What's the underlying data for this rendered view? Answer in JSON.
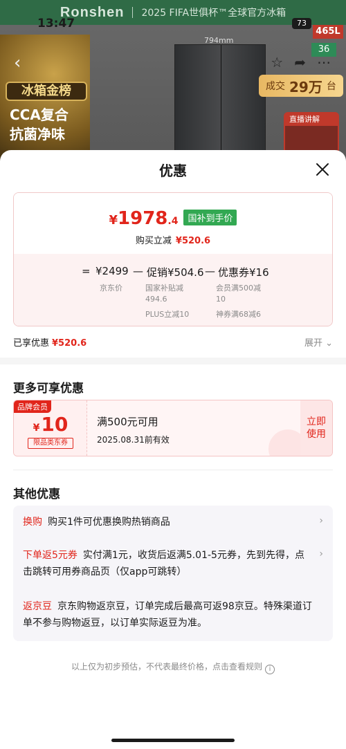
{
  "background": {
    "brand": "Ronshen",
    "banner_text": "2025 FIFA世俱杯™全球官方冰箱",
    "status_time": "13:47",
    "battery": "73",
    "rank_label": "冰箱金榜",
    "cca_line1": "CCA复合",
    "cca_line2": "抗菌净味",
    "dimension": "794mm",
    "capacity": "465L",
    "capacity2": "36",
    "sold_prefix": "成交",
    "sold_value": "29万",
    "sold_suffix": "台",
    "live_label": "直播讲解"
  },
  "sheet": {
    "title": "优惠",
    "price_card": {
      "final_price_yen": "¥",
      "final_price_int": "1978",
      "final_price_dec": ".4",
      "gov_badge": "国补到手价",
      "discount_label": "购买立减",
      "discount_value": "¥520.6",
      "eq": "=",
      "base_price": "¥2499",
      "minus1": "—",
      "promo": "促销¥504.6",
      "minus2": "—",
      "coupon": "优惠券¥16",
      "base_note": "京东价",
      "promo_note1a": "国家补贴减",
      "promo_note1b": "494.6",
      "promo_note2": "PLUS立减10",
      "coupon_note1a": "会员满500减",
      "coupon_note1b": "10",
      "coupon_note2": "神券满68减6"
    },
    "enjoyed_label": "已享优惠",
    "enjoyed_value": "¥520.6",
    "expand_label": "展开"
  },
  "more_offers": {
    "title": "更多可享优惠",
    "coupon": {
      "tag": "品牌会员",
      "yen": "¥",
      "value": "10",
      "type": "限品类东券",
      "condition": "满500元可用",
      "expiry": "2025.08.31前有效",
      "action_line1": "立即",
      "action_line2": "使用"
    }
  },
  "other_offers": {
    "title": "其他优惠",
    "items": [
      {
        "label": "换购",
        "text": "购买1件可优惠换购热销商品"
      },
      {
        "label": "下单返5元券",
        "text": "实付满1元，收货后返满5.01-5元券，先到先得，点击跳转可用券商品页（仅app可跳转）"
      },
      {
        "label": "返京豆",
        "text": "京东购物返京豆，订单完成后最高可返98京豆。特殊渠道订单不参与购物返豆，以订单实际返豆为准。"
      }
    ]
  },
  "footer": {
    "note": "以上仅为初步预估，不代表最终价格，点击查看规则",
    "info_icon": "i"
  },
  "colors": {
    "accent_red": "#e1251b",
    "badge_green": "#32a852"
  }
}
